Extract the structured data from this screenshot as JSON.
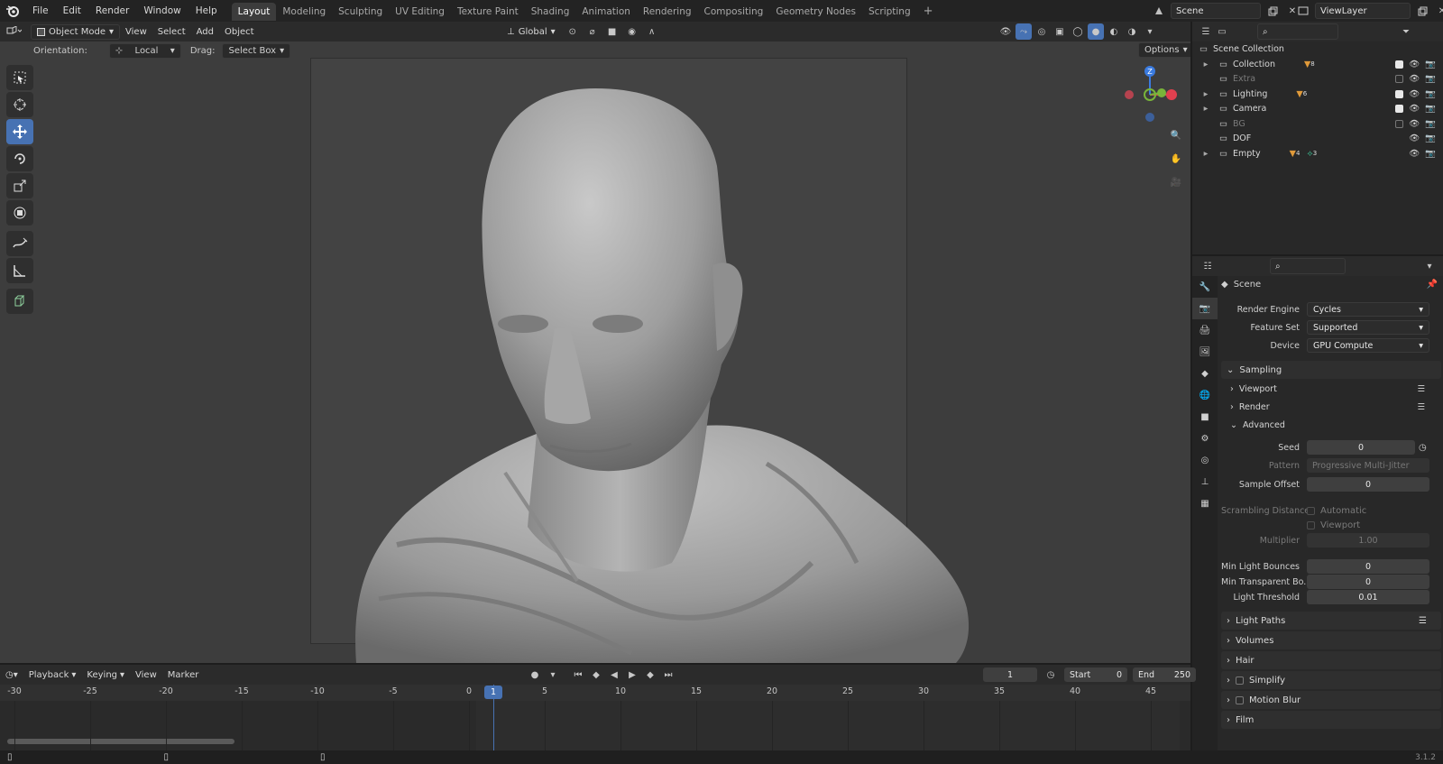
{
  "menubar": {
    "items": [
      "File",
      "Edit",
      "Render",
      "Window",
      "Help"
    ],
    "workspace_tabs": [
      "Layout",
      "Modeling",
      "Sculpting",
      "UV Editing",
      "Texture Paint",
      "Shading",
      "Animation",
      "Rendering",
      "Compositing",
      "Geometry Nodes",
      "Scripting"
    ],
    "active_tab": "Layout",
    "scene": "Scene",
    "view_layer": "ViewLayer"
  },
  "viewport": {
    "mode": "Object Mode",
    "menus": [
      "View",
      "Select",
      "Add",
      "Object"
    ],
    "transform_orientation": "Global",
    "orientation_label": "Orientation:",
    "orientation_value": "Local",
    "drag_label": "Drag:",
    "drag_value": "Select Box",
    "options_label": "Options",
    "gizmo_axis_label": "Z"
  },
  "toolbar": {
    "tools": [
      "select-box",
      "cursor",
      "move",
      "rotate",
      "scale",
      "transform",
      "annotate",
      "measure",
      "add-cube"
    ],
    "active": "move"
  },
  "outliner": {
    "root": "Scene Collection",
    "rows": [
      {
        "label": "Collection",
        "count": "8",
        "checked": true,
        "dim": false,
        "expand": true
      },
      {
        "label": "Extra",
        "count": "",
        "checked": false,
        "dim": true,
        "expand": false
      },
      {
        "label": "Lighting",
        "count": "6",
        "checked": true,
        "dim": false,
        "expand": true
      },
      {
        "label": "Camera",
        "count": "",
        "checked": true,
        "dim": false,
        "expand": true
      },
      {
        "label": "BG",
        "count": "",
        "checked": false,
        "dim": true,
        "expand": false
      },
      {
        "label": "DOF",
        "count": "",
        "checked": null,
        "dim": false,
        "expand": false
      },
      {
        "label": "Empty",
        "count": "4",
        "count2": "3",
        "checked": null,
        "dim": false,
        "expand": true
      }
    ]
  },
  "properties": {
    "context": "Scene",
    "render_engine_label": "Render Engine",
    "render_engine": "Cycles",
    "feature_set_label": "Feature Set",
    "feature_set": "Supported",
    "device_label": "Device",
    "device": "GPU Compute",
    "sampling": "Sampling",
    "viewport": "Viewport",
    "render": "Render",
    "advanced": "Advanced",
    "seed_label": "Seed",
    "seed": "0",
    "pattern_label": "Pattern",
    "pattern": "Progressive Multi-Jitter",
    "sample_offset_label": "Sample Offset",
    "sample_offset": "0",
    "scrambling_label": "Scrambling Distance",
    "automatic": "Automatic",
    "viewport_chk": "Viewport",
    "multiplier_label": "Multiplier",
    "multiplier": "1.00",
    "min_light_bounces_label": "Min Light Bounces",
    "min_light_bounces": "0",
    "min_transparent_label": "Min Transparent Bo...",
    "min_transparent": "0",
    "light_threshold_label": "Light Threshold",
    "light_threshold": "0.01",
    "panels": [
      "Light Paths",
      "Volumes",
      "Hair",
      "Simplify",
      "Motion Blur",
      "Film"
    ]
  },
  "timeline": {
    "menus": [
      "Playback",
      "Keying",
      "View",
      "Marker"
    ],
    "current_frame": "1",
    "start_label": "Start",
    "start": "0",
    "end_label": "End",
    "end": "250",
    "ticks": [
      "-30",
      "-25",
      "-20",
      "-15",
      "-10",
      "-5",
      "0",
      "5",
      "10",
      "15",
      "20",
      "25",
      "30",
      "35",
      "40",
      "45"
    ]
  },
  "status": {
    "version": "3.1.2"
  },
  "colors": {
    "accent": "#4772b3",
    "x_axis": "#e0404f",
    "y_axis": "#79b43a",
    "z_axis": "#3a7be0"
  }
}
